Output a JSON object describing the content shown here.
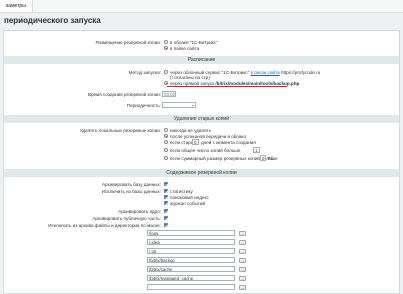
{
  "top_tab": "заметры",
  "page_title": "периодического запуска",
  "storage": {
    "label": "Размещение резервной копии:",
    "opt1": "в облаке \"1С-Битрикс\"",
    "opt2": "в папке сайта"
  },
  "schedule": {
    "section": "Расписание",
    "method_label": "Метод запуска:",
    "opt1_prefix": "через облачный сервис \"1С-Битрикс\"",
    "opt1_link": "(список сайта",
    "opt1_suffix": "https://profycode.ru",
    "opt1_line2": "(! отлаганы на стр)",
    "opt2_prefix": "через прямой запуск",
    "opt2_path": "/bitrix/modules/main/tools/backup.php",
    "time_label": "Время создания резервной копии:",
    "time_value": "00:00",
    "period_label": "Периодичность:"
  },
  "cleanup": {
    "section": "Удаление старых копий",
    "label": "Удалять локальные резервные копии:",
    "opt1": "никогда не удалять",
    "opt2": "после успешной передачи в облако",
    "opt3_prefix": "если старше",
    "opt3_value": "0",
    "opt3_suffix": "дней с момента создания",
    "opt4_prefix": "если общее число копий больше",
    "opt4_value": "1",
    "opt5_prefix": "если суммарный размер резервных копий больше",
    "opt5_value": "0",
    "opt5_unit": "Гб"
  },
  "content": {
    "section": "Содержимое резервной копии",
    "archive_db": "Архивировать базу данных:",
    "exclude_db": "Исключить из базы данных:",
    "ex1": "статистику",
    "ex2": "поисковый индекс",
    "ex3": "журнал событий",
    "archive_core": "Архивировать ядро:",
    "archive_public": "Архивировать публичную часть:",
    "exclude_files": "Исключить из архива файлы и директории по маске:",
    "masks": [
      "/logs",
      "/.idea",
      "/.git",
      "/bitrix/backup",
      "/bitrix/cache",
      "/bitrix/managed_cache",
      ""
    ],
    "btn": "..."
  }
}
